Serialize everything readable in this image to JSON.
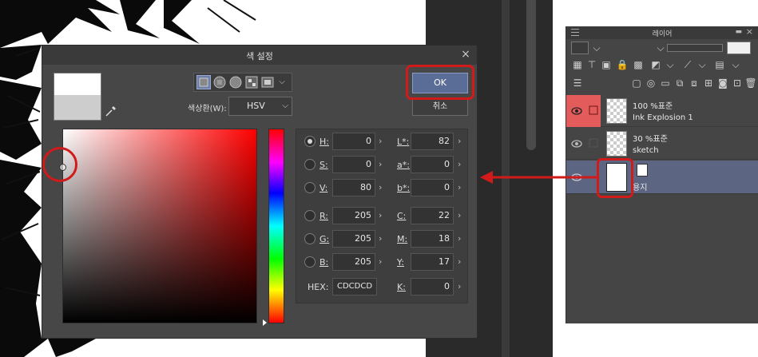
{
  "dialog": {
    "title": "색 설정",
    "close_glyph": "×",
    "ok_label": "OK",
    "cancel_label": "취소",
    "colorspace_label": "색상환(W):",
    "colorspace_value": "HSV",
    "main_color": "#ffffff",
    "sub_color": "#cdcdcd",
    "mode_icons": [
      "square-icon",
      "ring-square-icon",
      "circle-icon",
      "dots-icon",
      "film-icon"
    ],
    "values_left": [
      {
        "label": "H:",
        "value": "0",
        "selected": true
      },
      {
        "label": "S:",
        "value": "0",
        "selected": false
      },
      {
        "label": "V:",
        "value": "80",
        "selected": false
      },
      {
        "label": "R:",
        "value": "205",
        "selected": false
      },
      {
        "label": "G:",
        "value": "205",
        "selected": false
      },
      {
        "label": "B:",
        "value": "205",
        "selected": false
      }
    ],
    "values_right": [
      {
        "label": "L*:",
        "value": "82"
      },
      {
        "label": "a*:",
        "value": "0"
      },
      {
        "label": "b*:",
        "value": "0"
      },
      {
        "label": "C:",
        "value": "22"
      },
      {
        "label": "M:",
        "value": "18"
      },
      {
        "label": "Y:",
        "value": "17"
      },
      {
        "label": "K:",
        "value": "0"
      }
    ],
    "hex_label": "HEX:",
    "hex_value": "CDCDCD"
  },
  "layer_panel": {
    "title": "레이어",
    "layers": [
      {
        "blend": "100 %표준",
        "name": "Ink Explosion 1",
        "visible": true,
        "highlight": true
      },
      {
        "blend": "30 %표준",
        "name": "sketch",
        "visible": true,
        "highlight": false
      },
      {
        "blend": "",
        "name": "용지",
        "visible": true,
        "highlight": false,
        "selected": true
      }
    ]
  },
  "colors": {
    "accent": "#5a6d96",
    "marker_red": "#d11a1a",
    "layer_highlight": "#e35b5b",
    "selected_layer": "#5c6582"
  }
}
